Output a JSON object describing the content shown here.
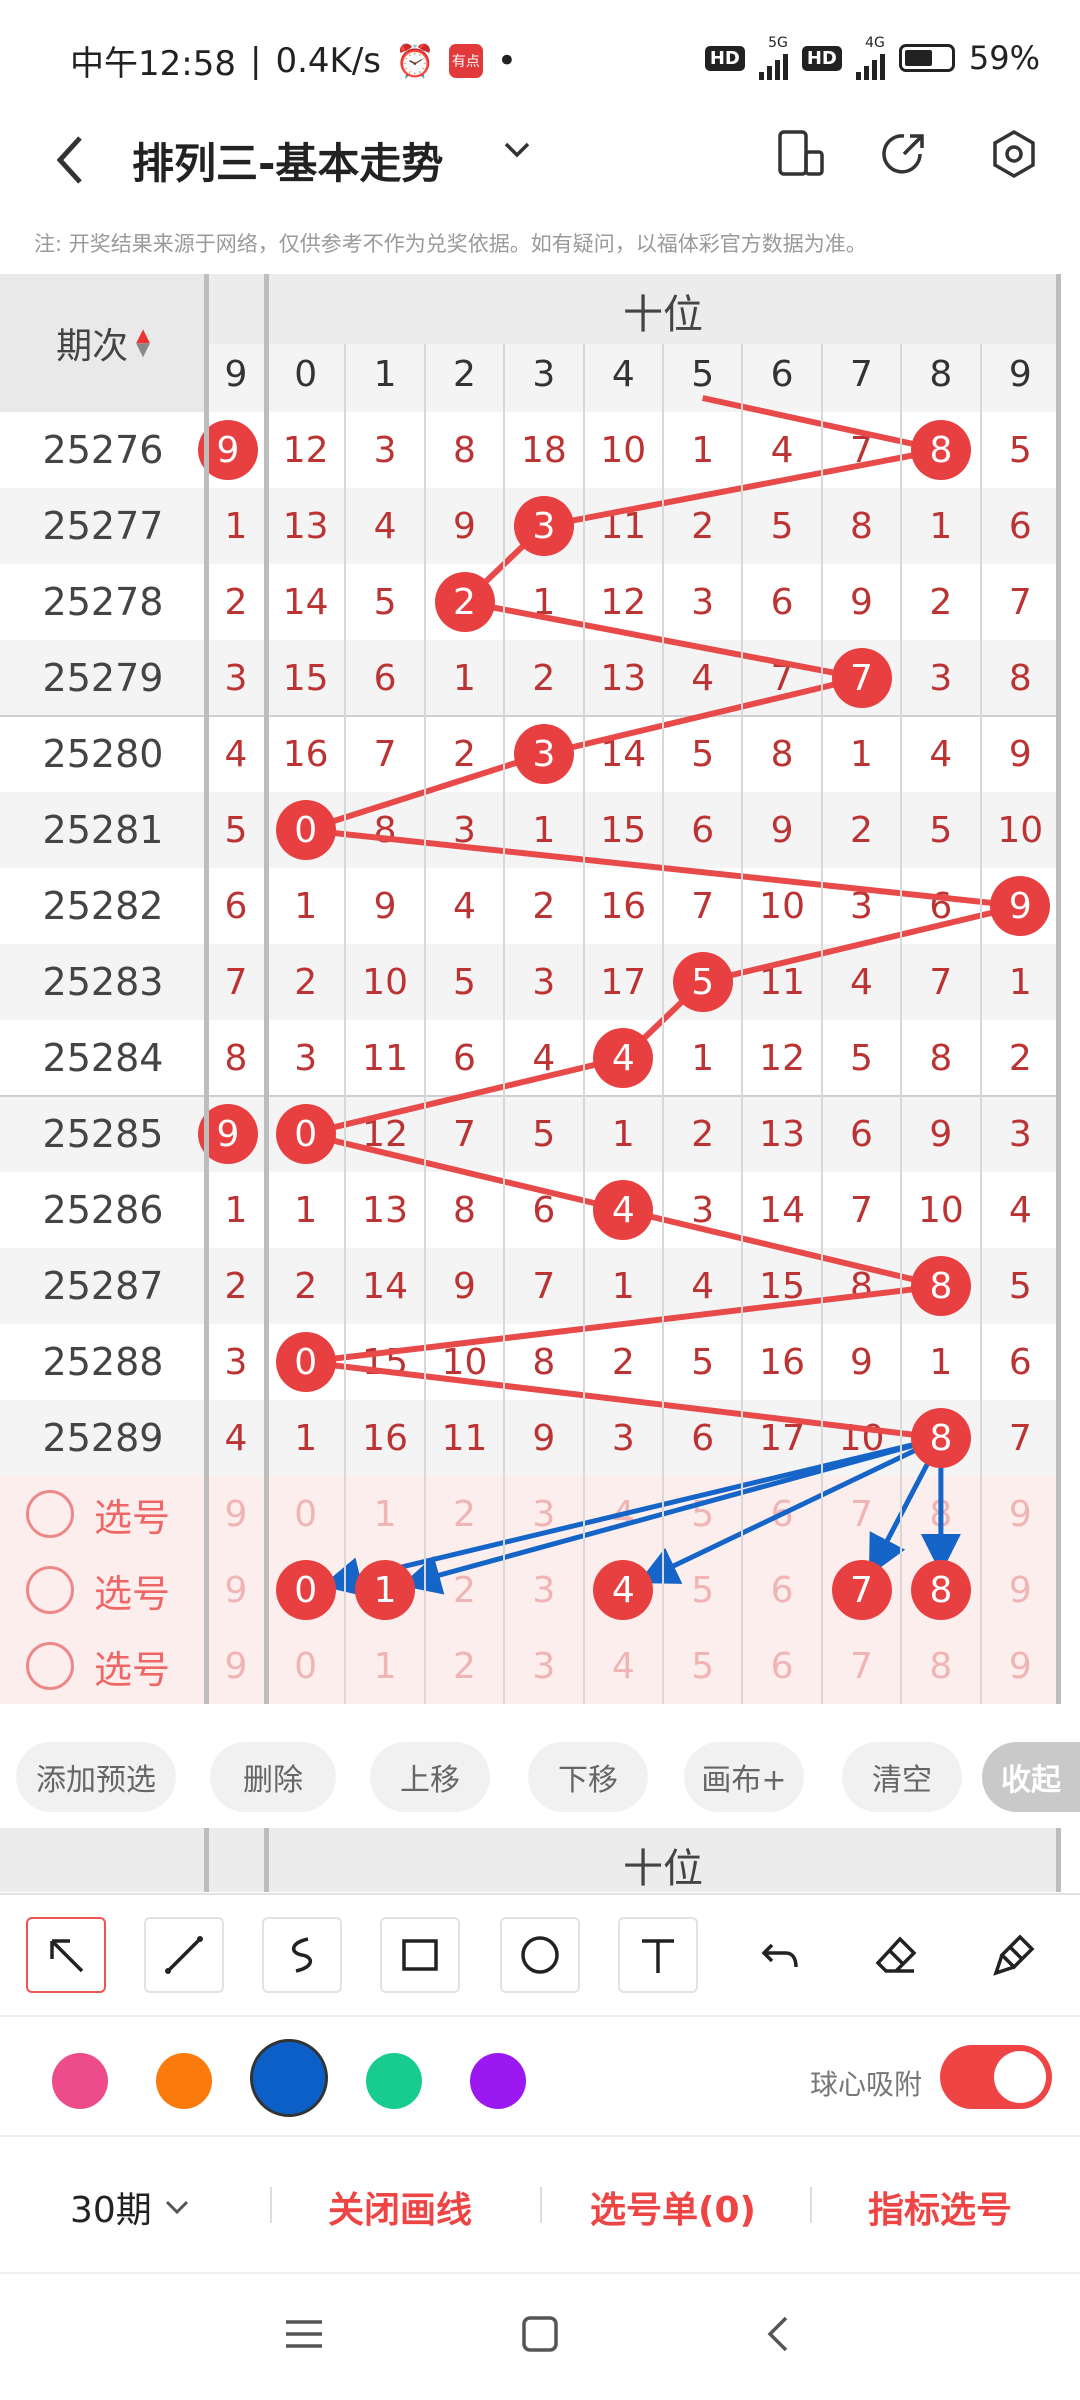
{
  "status": {
    "time": "中午12:58",
    "speed": "0.4K/s",
    "hd1": "HD",
    "net1": "5G",
    "hd2": "HD",
    "net2": "4G",
    "battery": "59%",
    "notif_app": "有点"
  },
  "appbar": {
    "title": "排列三-基本走势",
    "back_icon": "chevron-left-icon",
    "icons": [
      "screen-icon",
      "share-icon",
      "settings-icon"
    ]
  },
  "notice": "注: 开奖结果来源于网络，仅供参考不作为兑奖依据。如有疑问，以福体彩官方数据为准。",
  "table": {
    "period_header": "期次",
    "group_label": "十位",
    "prev_digit_header": "9",
    "digit_headers": [
      "0",
      "1",
      "2",
      "3",
      "4",
      "5",
      "6",
      "7",
      "8",
      "9"
    ],
    "rows": [
      {
        "period": "25276",
        "prev": "9",
        "prev_hit": true,
        "cells": [
          "12",
          "3",
          "8",
          "18",
          "10",
          "1",
          "4",
          "7",
          "8",
          "5"
        ],
        "hit": 8
      },
      {
        "period": "25277",
        "prev": "1",
        "prev_hit": false,
        "cells": [
          "13",
          "4",
          "9",
          "3",
          "11",
          "2",
          "5",
          "8",
          "1",
          "6"
        ],
        "hit": 3
      },
      {
        "period": "25278",
        "prev": "2",
        "prev_hit": false,
        "cells": [
          "14",
          "5",
          "2",
          "1",
          "12",
          "3",
          "6",
          "9",
          "2",
          "7"
        ],
        "hit": 2
      },
      {
        "period": "25279",
        "prev": "3",
        "prev_hit": false,
        "cells": [
          "15",
          "6",
          "1",
          "2",
          "13",
          "4",
          "7",
          "7",
          "3",
          "8"
        ],
        "hit": 7
      },
      {
        "period": "25280",
        "prev": "4",
        "prev_hit": false,
        "cells": [
          "16",
          "7",
          "2",
          "3",
          "14",
          "5",
          "8",
          "1",
          "4",
          "9"
        ],
        "hit": 3
      },
      {
        "period": "25281",
        "prev": "5",
        "prev_hit": false,
        "cells": [
          "0",
          "8",
          "3",
          "1",
          "15",
          "6",
          "9",
          "2",
          "5",
          "10"
        ],
        "hit": 0
      },
      {
        "period": "25282",
        "prev": "6",
        "prev_hit": false,
        "cells": [
          "1",
          "9",
          "4",
          "2",
          "16",
          "7",
          "10",
          "3",
          "6",
          "9"
        ],
        "hit": 9
      },
      {
        "period": "25283",
        "prev": "7",
        "prev_hit": false,
        "cells": [
          "2",
          "10",
          "5",
          "3",
          "17",
          "5",
          "11",
          "4",
          "7",
          "1"
        ],
        "hit": 5
      },
      {
        "period": "25284",
        "prev": "8",
        "prev_hit": false,
        "cells": [
          "3",
          "11",
          "6",
          "4",
          "4",
          "1",
          "12",
          "5",
          "8",
          "2"
        ],
        "hit": 4
      },
      {
        "period": "25285",
        "prev": "9",
        "prev_hit": true,
        "cells": [
          "0",
          "12",
          "7",
          "5",
          "1",
          "2",
          "13",
          "6",
          "9",
          "3"
        ],
        "hit": 0
      },
      {
        "period": "25286",
        "prev": "1",
        "prev_hit": false,
        "cells": [
          "1",
          "13",
          "8",
          "6",
          "4",
          "3",
          "14",
          "7",
          "10",
          "4"
        ],
        "hit": 4
      },
      {
        "period": "25287",
        "prev": "2",
        "prev_hit": false,
        "cells": [
          "2",
          "14",
          "9",
          "7",
          "1",
          "4",
          "15",
          "8",
          "8",
          "5"
        ],
        "hit": 8
      },
      {
        "period": "25288",
        "prev": "3",
        "prev_hit": false,
        "cells": [
          "0",
          "15",
          "10",
          "8",
          "2",
          "5",
          "16",
          "9",
          "1",
          "6"
        ],
        "hit": 0
      },
      {
        "period": "25289",
        "prev": "4",
        "prev_hit": false,
        "cells": [
          "1",
          "16",
          "11",
          "9",
          "3",
          "6",
          "17",
          "10",
          "8",
          "7"
        ],
        "hit": 8
      }
    ],
    "select_label": "选号",
    "select_rows": [
      {
        "prev": "9",
        "cells": [
          "0",
          "1",
          "2",
          "3",
          "4",
          "5",
          "6",
          "7",
          "8",
          "9"
        ],
        "picked": []
      },
      {
        "prev": "9",
        "cells": [
          "0",
          "1",
          "2",
          "3",
          "4",
          "5",
          "6",
          "7",
          "8",
          "9"
        ],
        "picked": [
          0,
          1,
          4,
          7,
          8
        ]
      },
      {
        "prev": "9",
        "cells": [
          "0",
          "1",
          "2",
          "3",
          "4",
          "5",
          "6",
          "7",
          "8",
          "9"
        ],
        "picked": []
      }
    ]
  },
  "actions": [
    "添加预选",
    "删除",
    "上移",
    "下移",
    "画布+",
    "清空",
    "收起"
  ],
  "footer_group_label": "十位",
  "tools": [
    "arrow-tool-icon",
    "line-tool-icon",
    "curve-tool-icon",
    "rect-tool-icon",
    "circle-tool-icon",
    "text-tool-icon",
    "undo-icon",
    "eraser-icon",
    "clear-brush-icon"
  ],
  "colors": [
    "#ee4b8a",
    "#fb7a0c",
    "#0b5fc6",
    "#18cc8f",
    "#9b19f0"
  ],
  "snap_label": "球心吸附",
  "bottom": {
    "periods": "30期",
    "close_draw": "关闭画线",
    "select_list": "选号单(0)",
    "indicator": "指标选号"
  }
}
